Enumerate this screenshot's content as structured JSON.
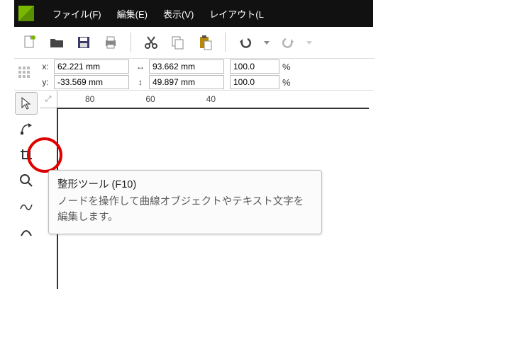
{
  "menu": {
    "file": "ファイル(F)",
    "edit": "編集(E)",
    "view": "表示(V)",
    "layout": "レイアウト(L"
  },
  "propbar": {
    "x_label": "x:",
    "y_label": "y:",
    "x_value": "62.221 mm",
    "y_value": "-33.569 mm",
    "w_value": "93.662 mm",
    "h_value": "49.897 mm",
    "sx_value": "100.0",
    "sy_value": "100.0",
    "percent": "%"
  },
  "ruler": {
    "t80": "80",
    "t60": "60",
    "t40": "40"
  },
  "tooltip": {
    "title": "整形ツール (F10)",
    "body": "ノードを操作して曲線オブジェクトやテキスト文字を編集します。"
  }
}
